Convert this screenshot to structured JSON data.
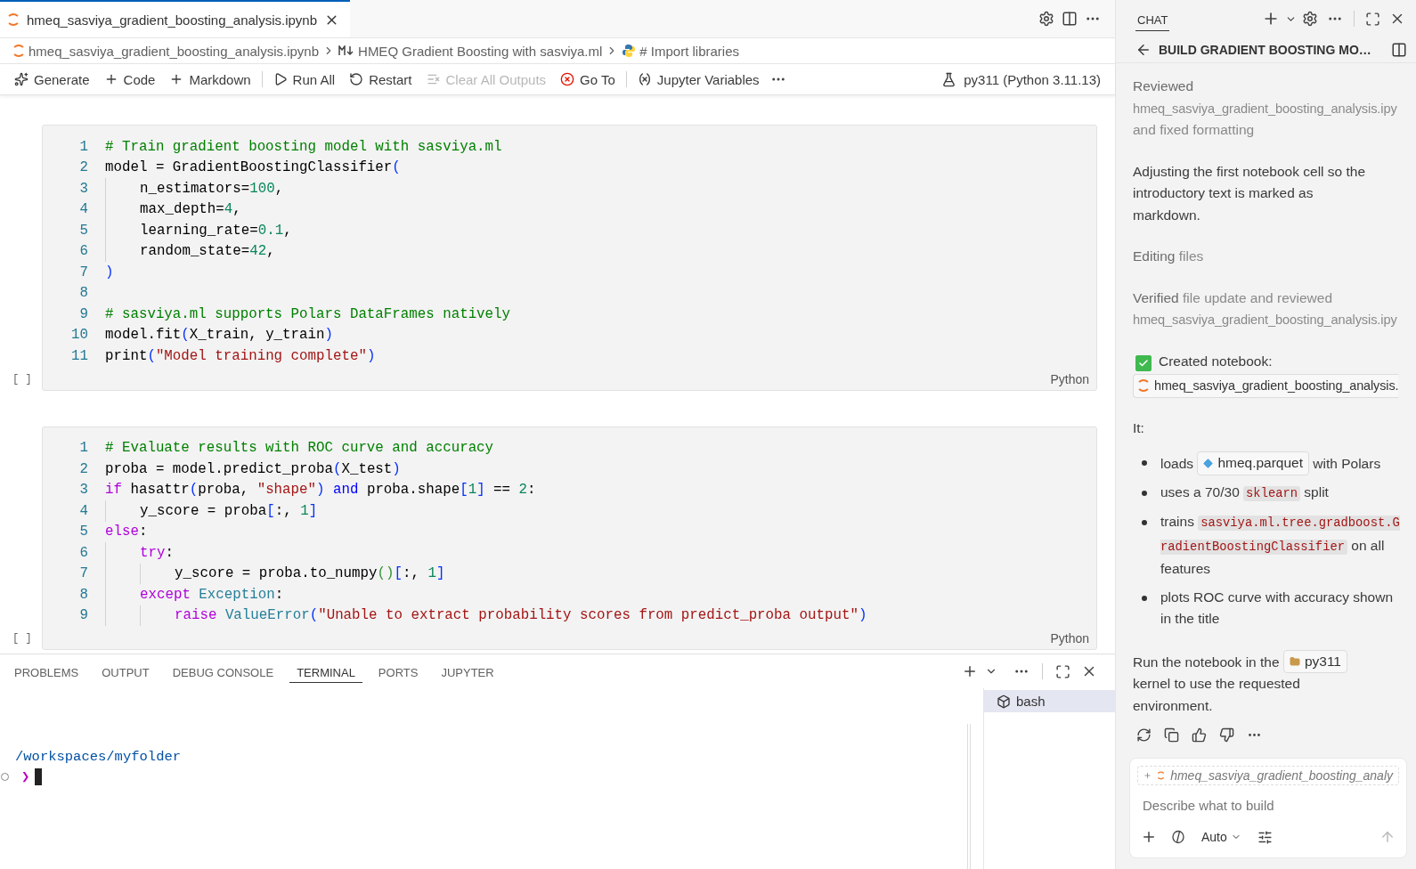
{
  "editor_tab": {
    "title": "hmeq_sasviya_gradient_boosting_analysis.ipynb",
    "selected": true
  },
  "breadcrumb": [
    {
      "kind": "notebook",
      "label": "hmeq_sasviya_gradient_boosting_analysis.ipynb"
    },
    {
      "kind": "markdown",
      "label": "HMEQ Gradient Boosting with sasviya.ml"
    },
    {
      "kind": "python",
      "label": "# Import libraries"
    }
  ],
  "toolbar": [
    {
      "kind": "generate",
      "label": "Generate",
      "disabled": false
    },
    {
      "kind": "add",
      "label": "Code",
      "disabled": false
    },
    {
      "kind": "add",
      "label": "Markdown",
      "disabled": false
    },
    {
      "kind": "separator"
    },
    {
      "kind": "run",
      "label": "Run All",
      "disabled": false
    },
    {
      "kind": "restart",
      "label": "Restart",
      "disabled": false
    },
    {
      "kind": "clear",
      "label": "Clear All Outputs",
      "disabled": true
    },
    {
      "kind": "goto",
      "label": "Go To",
      "disabled": false
    },
    {
      "kind": "separator"
    },
    {
      "kind": "variables",
      "label": "Jupyter Variables",
      "disabled": false
    },
    {
      "kind": "more"
    }
  ],
  "kernel": "py311 (Python 3.11.13)",
  "cells": [
    {
      "bracket": "[ ]",
      "language": "Python",
      "lines": [
        {
          "n": "1",
          "tokens": [
            {
              "text": "# Train gradient boosting model with sasviya.ml",
              "kind": "comment"
            }
          ]
        },
        {
          "n": "2",
          "tokens": [
            {
              "text": "model = GradientBoostingClassifier",
              "kind": "plain"
            },
            {
              "text": "(",
              "kind": "bracket"
            }
          ]
        },
        {
          "n": "3",
          "tokens": [
            {
              "text": "    n_estimators=",
              "kind": "plain"
            },
            {
              "text": "100",
              "kind": "number"
            },
            {
              "text": ",",
              "kind": "plain"
            }
          ]
        },
        {
          "n": "4",
          "tokens": [
            {
              "text": "    max_depth=",
              "kind": "plain"
            },
            {
              "text": "4",
              "kind": "number"
            },
            {
              "text": ",",
              "kind": "plain"
            }
          ]
        },
        {
          "n": "5",
          "tokens": [
            {
              "text": "    learning_rate=",
              "kind": "plain"
            },
            {
              "text": "0.1",
              "kind": "number"
            },
            {
              "text": ",",
              "kind": "plain"
            }
          ]
        },
        {
          "n": "6",
          "tokens": [
            {
              "text": "    random_state=",
              "kind": "plain"
            },
            {
              "text": "42",
              "kind": "number"
            },
            {
              "text": ",",
              "kind": "plain"
            }
          ]
        },
        {
          "n": "7",
          "tokens": [
            {
              "text": ")",
              "kind": "bracket"
            }
          ]
        },
        {
          "n": "8"
        },
        {
          "n": "9",
          "tokens": [
            {
              "text": "# sasviya.ml supports Polars DataFrames natively",
              "kind": "comment"
            }
          ]
        },
        {
          "n": "10",
          "tokens": [
            {
              "text": "model.fit",
              "kind": "plain"
            },
            {
              "text": "(",
              "kind": "bracket"
            },
            {
              "text": "X_train, y_train",
              "kind": "plain"
            },
            {
              "text": ")",
              "kind": "bracket"
            }
          ]
        },
        {
          "n": "11",
          "tokens": [
            {
              "text": "print",
              "kind": "plain"
            },
            {
              "text": "(",
              "kind": "bracket"
            },
            {
              "text": "\"Model training complete\"",
              "kind": "string"
            },
            {
              "text": ")",
              "kind": "bracket"
            }
          ]
        }
      ]
    },
    {
      "bracket": "[ ]",
      "language": "Python",
      "lines": [
        {
          "n": "1",
          "tokens": [
            {
              "text": "# Evaluate results with ROC curve and accuracy",
              "kind": "comment"
            }
          ]
        },
        {
          "n": "2",
          "tokens": [
            {
              "text": "proba = model.predict_proba",
              "kind": "plain"
            },
            {
              "text": "(",
              "kind": "bracket"
            },
            {
              "text": "X_test",
              "kind": "plain"
            },
            {
              "text": ")",
              "kind": "bracket"
            }
          ]
        },
        {
          "n": "3",
          "tokens": [
            {
              "text": "if",
              "kind": "control"
            },
            {
              "text": " hasattr",
              "kind": "plain"
            },
            {
              "text": "(",
              "kind": "bracket"
            },
            {
              "text": "proba, ",
              "kind": "plain"
            },
            {
              "text": "\"shape\"",
              "kind": "string"
            },
            {
              "text": ")",
              "kind": "bracket"
            },
            {
              "text": " and",
              "kind": "keyword"
            },
            {
              "text": " proba.shape",
              "kind": "plain"
            },
            {
              "text": "[",
              "kind": "bracket"
            },
            {
              "text": "1",
              "kind": "number"
            },
            {
              "text": "]",
              "kind": "bracket"
            },
            {
              "text": " == ",
              "kind": "plain"
            },
            {
              "text": "2",
              "kind": "number"
            },
            {
              "text": ":",
              "kind": "plain"
            }
          ]
        },
        {
          "n": "4",
          "tokens": [
            {
              "text": "    y_score = proba",
              "kind": "plain"
            },
            {
              "text": "[",
              "kind": "bracket"
            },
            {
              "text": ":, ",
              "kind": "plain"
            },
            {
              "text": "1",
              "kind": "number"
            },
            {
              "text": "]",
              "kind": "bracket"
            }
          ]
        },
        {
          "n": "5",
          "tokens": [
            {
              "text": "else",
              "kind": "control"
            },
            {
              "text": ":",
              "kind": "plain"
            }
          ]
        },
        {
          "n": "6",
          "tokens": [
            {
              "text": "    try",
              "kind": "control"
            },
            {
              "text": ":",
              "kind": "plain"
            }
          ]
        },
        {
          "n": "7",
          "tokens": [
            {
              "text": "        y_score = proba.to_numpy",
              "kind": "plain"
            },
            {
              "text": "()",
              "kind": "bracket2"
            },
            {
              "text": "[",
              "kind": "bracket"
            },
            {
              "text": ":, ",
              "kind": "plain"
            },
            {
              "text": "1",
              "kind": "number"
            },
            {
              "text": "]",
              "kind": "bracket"
            }
          ]
        },
        {
          "n": "8",
          "tokens": [
            {
              "text": "    except",
              "kind": "control"
            },
            {
              "text": " Exception",
              "kind": "class"
            },
            {
              "text": ":",
              "kind": "plain"
            }
          ]
        },
        {
          "n": "9",
          "tokens": [
            {
              "text": "        raise",
              "kind": "control"
            },
            {
              "text": " ValueError",
              "kind": "class"
            },
            {
              "text": "(",
              "kind": "bracket"
            },
            {
              "text": "\"Unable to extract probability scores from predict_proba output\"",
              "kind": "string"
            },
            {
              "text": ")",
              "kind": "bracket"
            }
          ]
        }
      ]
    }
  ],
  "panel": {
    "tabs": [
      {
        "label": "PROBLEMS",
        "selected": false
      },
      {
        "label": "OUTPUT",
        "selected": false
      },
      {
        "label": "DEBUG CONSOLE",
        "selected": false
      },
      {
        "label": "TERMINAL",
        "selected": true
      },
      {
        "label": "PORTS",
        "selected": false
      },
      {
        "label": "JUPYTER",
        "selected": false
      }
    ],
    "terminal": {
      "path": "/workspaces/myfolder",
      "prompt": "❯"
    },
    "sessions": [
      {
        "label": "bash",
        "selected": true
      }
    ]
  },
  "chat": {
    "tab": "CHAT",
    "title": "BUILD GRADIENT BOOSTING MO…",
    "blocks": [
      {
        "kind": "status",
        "parts": [
          {
            "text": "Reviewed",
            "kind": "lead"
          },
          {
            "text": "hmeq_sasviya_gradient_boosting_analysis.ipy",
            "kind": "file"
          },
          {
            "text": "and fixed formatting",
            "kind": "muted"
          }
        ]
      },
      {
        "kind": "text",
        "text": "Adjusting the first notebook cell so the introductory text is marked as markdown."
      },
      {
        "kind": "status",
        "parts": [
          {
            "text": "Editing",
            "kind": "lead"
          },
          {
            "text": " files",
            "kind": "muted"
          }
        ]
      },
      {
        "kind": "status",
        "parts": [
          {
            "text": "Verified",
            "kind": "lead"
          },
          {
            "text": " file update and reviewed",
            "kind": "muted"
          },
          {
            "text": "hmeq_sasviya_gradient_boosting_analysis.ipy",
            "kind": "file"
          }
        ]
      },
      {
        "kind": "created",
        "label": "Created notebook:",
        "checked": true,
        "file": "hmeq_sasviya_gradient_boosting_analysis."
      },
      {
        "kind": "text",
        "text": "It:"
      },
      {
        "kind": "bullets",
        "items": [
          [
            {
              "text": "loads ",
              "kind": "text"
            },
            {
              "text": "hmeq.parquet",
              "kind": "data"
            },
            {
              "text": " with Polars",
              "kind": "text"
            }
          ],
          [
            {
              "text": "uses a 70/30 ",
              "kind": "text"
            },
            {
              "text": "sklearn",
              "kind": "code"
            },
            {
              "text": " split",
              "kind": "text"
            }
          ],
          [
            {
              "text": "trains ",
              "kind": "text"
            },
            {
              "text": "sasviya.ml.tree.gradboost.GradientBoostingClassifier",
              "kind": "code"
            },
            {
              "text": " on all features",
              "kind": "text"
            }
          ],
          [
            {
              "text": "plots ROC curve with accuracy shown in the title",
              "kind": "text"
            }
          ]
        ]
      },
      {
        "kind": "mixed",
        "parts": [
          {
            "text": "Run the notebook in the ",
            "kind": "text"
          },
          {
            "text": "py311",
            "kind": "env"
          },
          {
            "text": " kernel to use the requested environment.",
            "kind": "text"
          }
        ]
      }
    ],
    "context_file": "hmeq_sasviya_gradient_boosting_analy",
    "input": {
      "placeholder": "Describe what to build"
    },
    "mode": "Auto"
  }
}
